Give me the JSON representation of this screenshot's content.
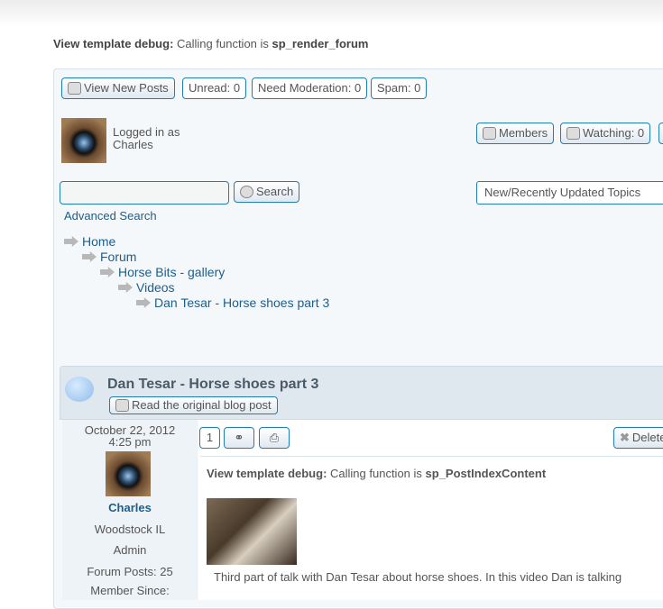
{
  "debug_top": {
    "label": "View template debug:",
    "text": " Calling function is ",
    "func": "sp_render_forum"
  },
  "toolbar": {
    "view_new_posts": "View New Posts",
    "unread": "Unread: 0",
    "need_moderation": "Need Moderation: 0",
    "spam": "Spam: 0",
    "members": "Members",
    "watching": "Watching: 0"
  },
  "user": {
    "logged_in_as": "Logged in as",
    "name": "Charles"
  },
  "search": {
    "value": "",
    "placeholder": "",
    "button": "Search",
    "advanced": "Advanced Search"
  },
  "topics_select": {
    "selected": "New/Recently Updated Topics"
  },
  "breadcrumbs": [
    {
      "label": "Home"
    },
    {
      "label": "Forum"
    },
    {
      "label": "Horse Bits - gallery"
    },
    {
      "label": "Videos"
    },
    {
      "label": "Dan Tesar - Horse shoes part 3"
    }
  ],
  "topic": {
    "title": "Dan Tesar - Horse shoes part 3",
    "read_original": "Read the original blog post"
  },
  "post": {
    "date": "October 22, 2012",
    "time": "4:25 pm",
    "author": "Charles",
    "location": "Woodstock IL",
    "role": "Admin",
    "forum_posts": "Forum Posts: 25",
    "member_since": "Member Since:",
    "number": "1",
    "delete": "Delete",
    "debug": {
      "label": "View template debug:",
      "text": " Calling function is ",
      "func": "sp_PostIndexContent"
    },
    "text": "Third part of talk with Dan Tesar about horse shoes. In this video Dan is talking"
  }
}
